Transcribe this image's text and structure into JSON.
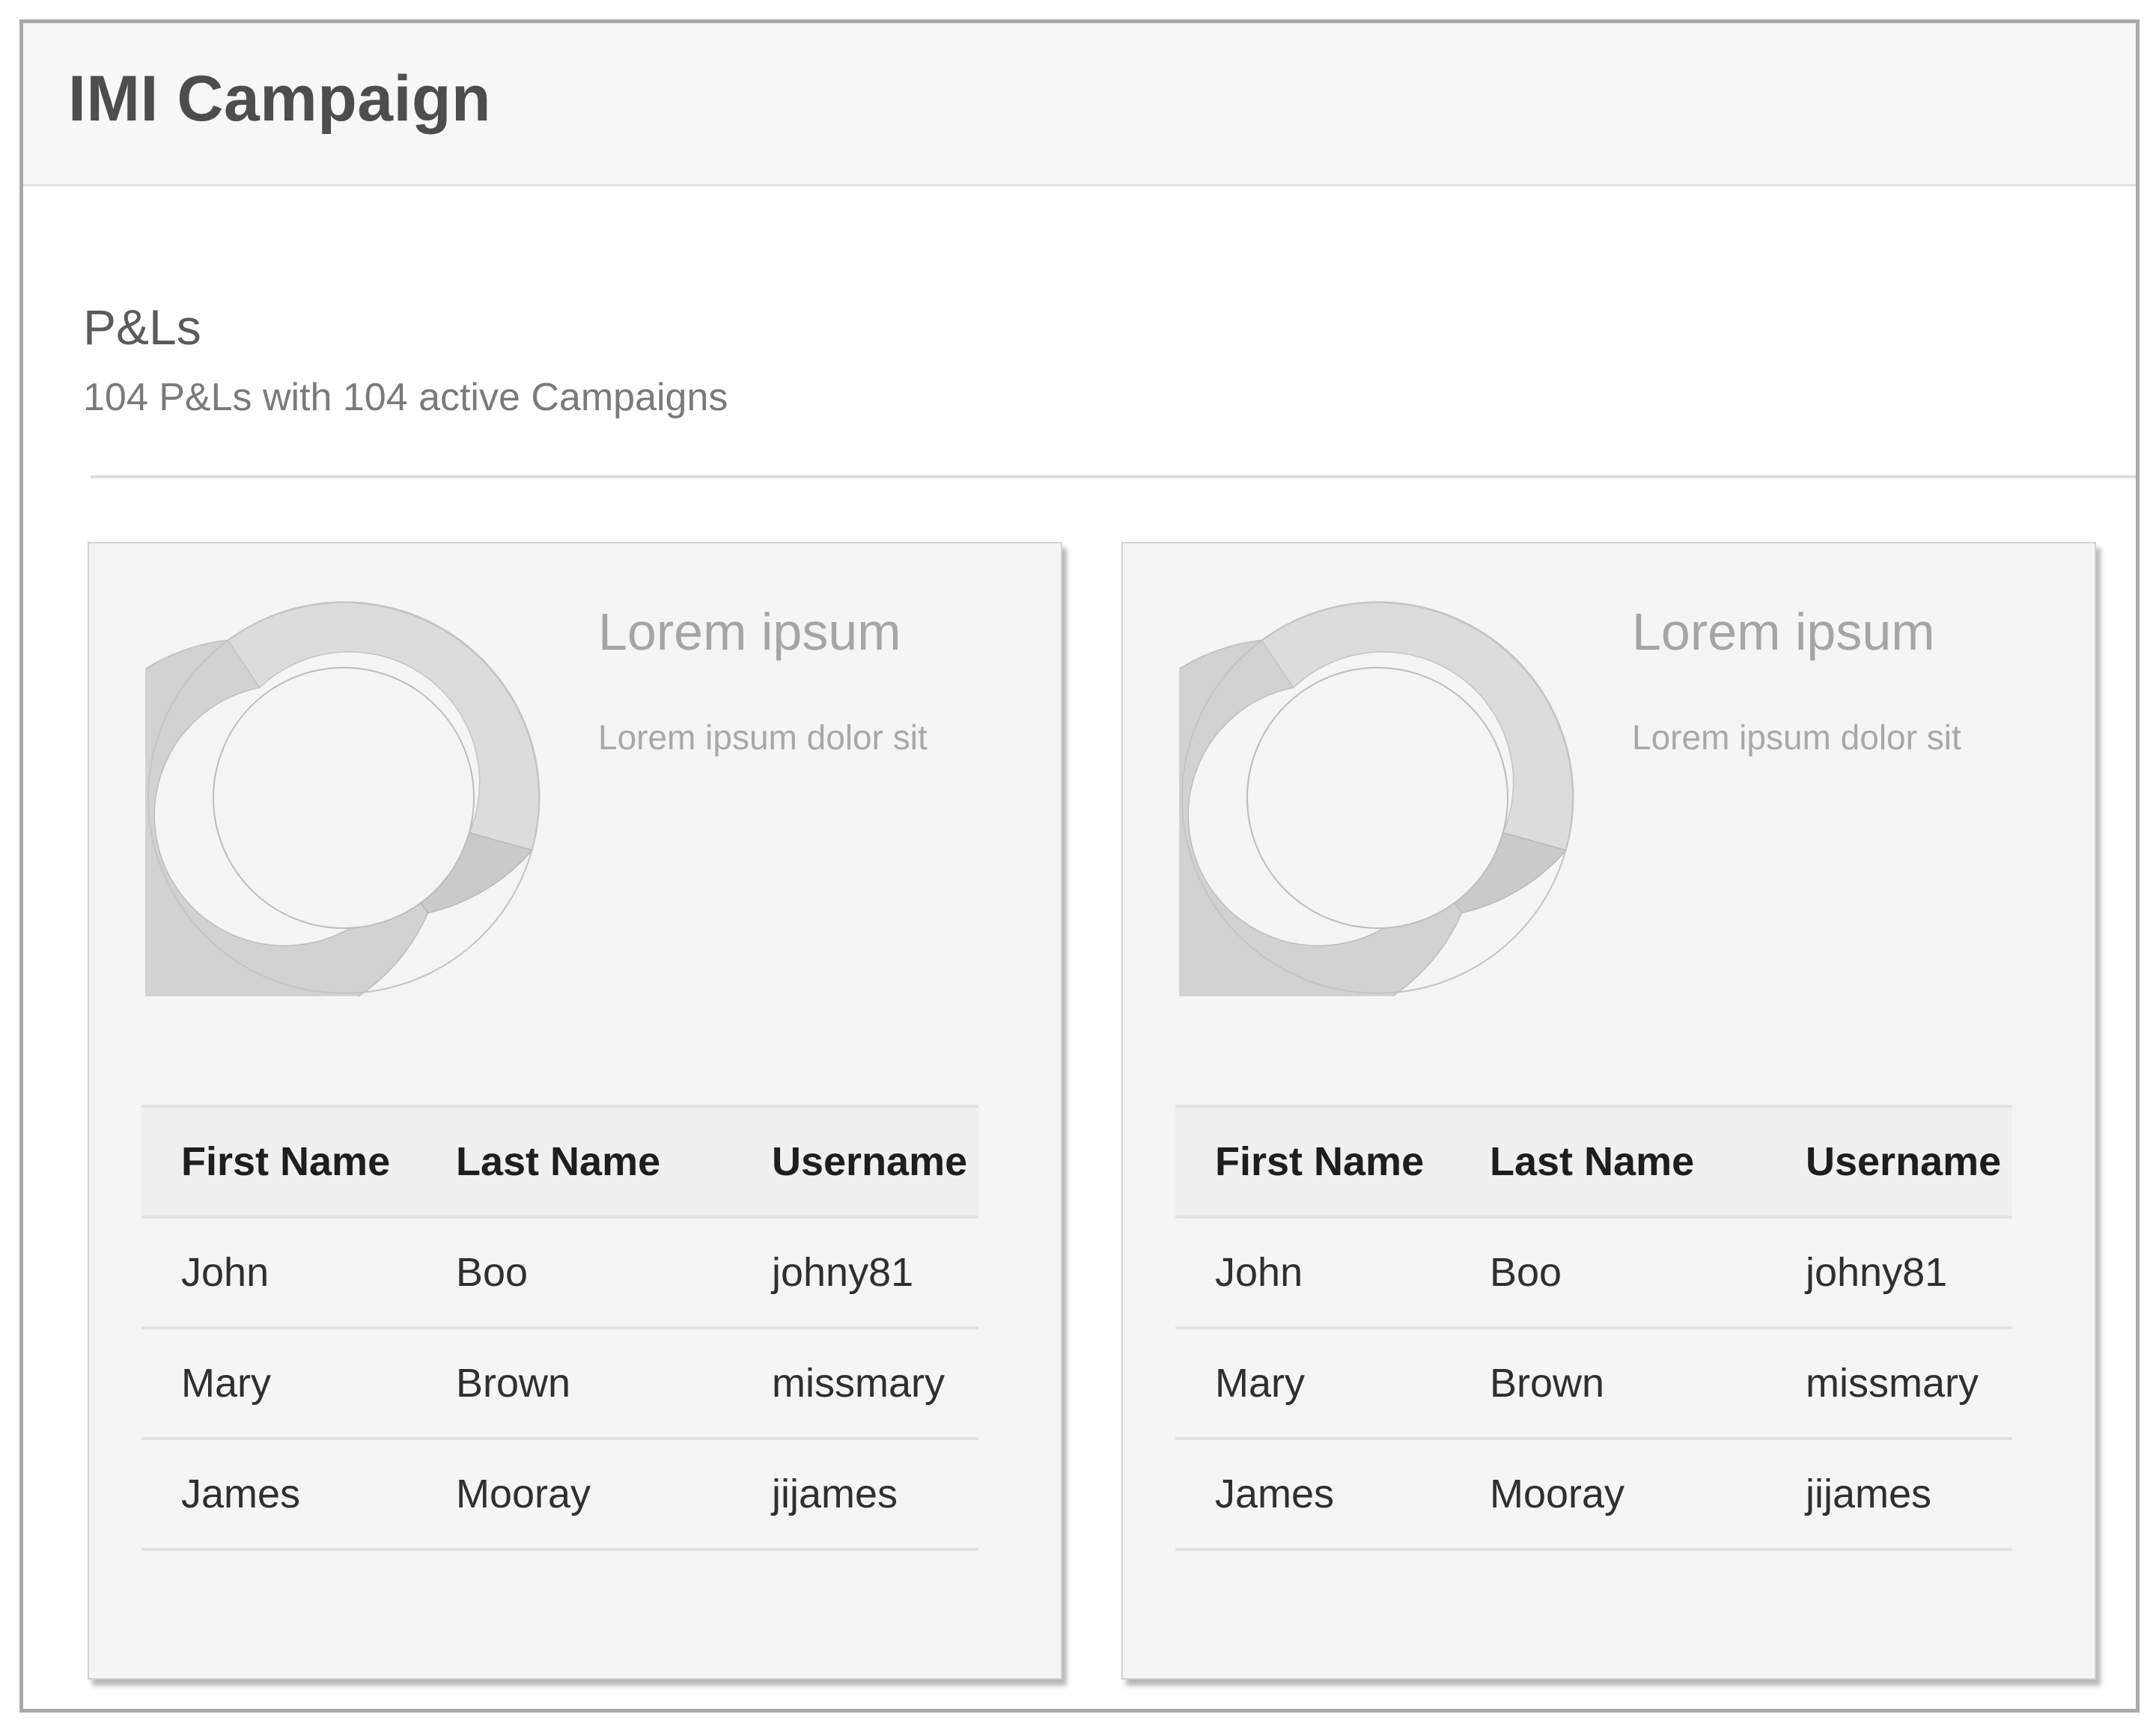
{
  "app": {
    "title": "IMI Campaign"
  },
  "section": {
    "title": "P&Ls",
    "subtitle": "104 P&Ls with 104 active Campaigns"
  },
  "colors": {
    "frame_border": "#a9a9a9",
    "header_bg": "#f7f7f7",
    "card_bg": "#f5f5f5",
    "donut_light": "#dcdcdc",
    "donut_mid": "#d2d2d2",
    "donut_dark": "#cacaca"
  },
  "cards": [
    {
      "title": "Lorem ipsum",
      "subtitle": "Lorem ipsum dolor sit",
      "table": {
        "columns": [
          "First Name",
          "Last Name",
          "Username"
        ],
        "rows": [
          [
            "John",
            "Boo",
            "johny81"
          ],
          [
            "Mary",
            "Brown",
            "missmary"
          ],
          [
            "James",
            "Mooray",
            "jijames"
          ]
        ]
      }
    },
    {
      "title": "Lorem ipsum",
      "subtitle": "Lorem ipsum dolor sit",
      "table": {
        "columns": [
          "First Name",
          "Last Name",
          "Username"
        ],
        "rows": [
          [
            "John",
            "Boo",
            "johny81"
          ],
          [
            "Mary",
            "Brown",
            "missmary"
          ],
          [
            "James",
            "Mooray",
            "jijames"
          ]
        ]
      }
    }
  ]
}
